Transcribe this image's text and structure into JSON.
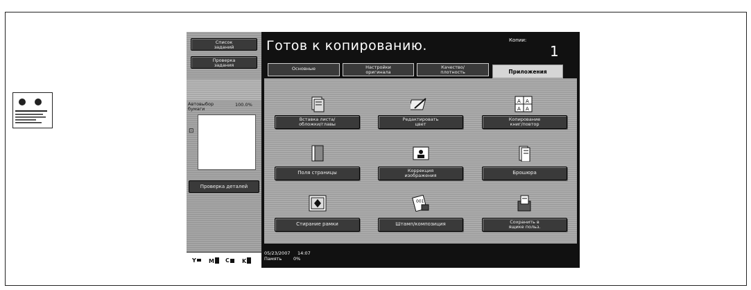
{
  "sidebar": {
    "job_list_label": "Список\nзаданий",
    "check_job_label": "Проверка\nзадания",
    "paper_auto_label": "Автовыбор\nбумаги",
    "zoom_value": "100.0%",
    "details_label": "Проверка деталей",
    "toner": [
      "Y",
      "M",
      "C",
      "K"
    ]
  },
  "header": {
    "status": "Готов к копированию.",
    "copies_label": "Копии:",
    "copies_value": "1"
  },
  "tabs": [
    {
      "label": "Основные"
    },
    {
      "label": "Настройки\nоригинала"
    },
    {
      "label": "Качество/\nплотность"
    },
    {
      "label": "Приложения"
    }
  ],
  "functions": [
    {
      "label": "Вставка листа/\nобложки/главы",
      "icon": "sheet-insert-icon"
    },
    {
      "label": "Редактировать\nцвет",
      "icon": "edit-color-icon"
    },
    {
      "label": "Копирование\nкниг/повтор",
      "icon": "book-copy-icon"
    },
    {
      "label": "Поля страницы",
      "icon": "page-margin-icon"
    },
    {
      "label": "Коррекция\nизображения",
      "icon": "image-adjust-icon"
    },
    {
      "label": "Брошюра",
      "icon": "booklet-icon"
    },
    {
      "label": "Стирание рамки",
      "icon": "frame-erase-icon"
    },
    {
      "label": "Штамп/композиция",
      "icon": "stamp-icon"
    },
    {
      "label": "Сохранить в\nящике польз.",
      "icon": "save-box-icon"
    }
  ],
  "footer": {
    "date": "05/23/2007",
    "time": "14:07",
    "memory_label": "Память",
    "memory_value": "0%"
  }
}
